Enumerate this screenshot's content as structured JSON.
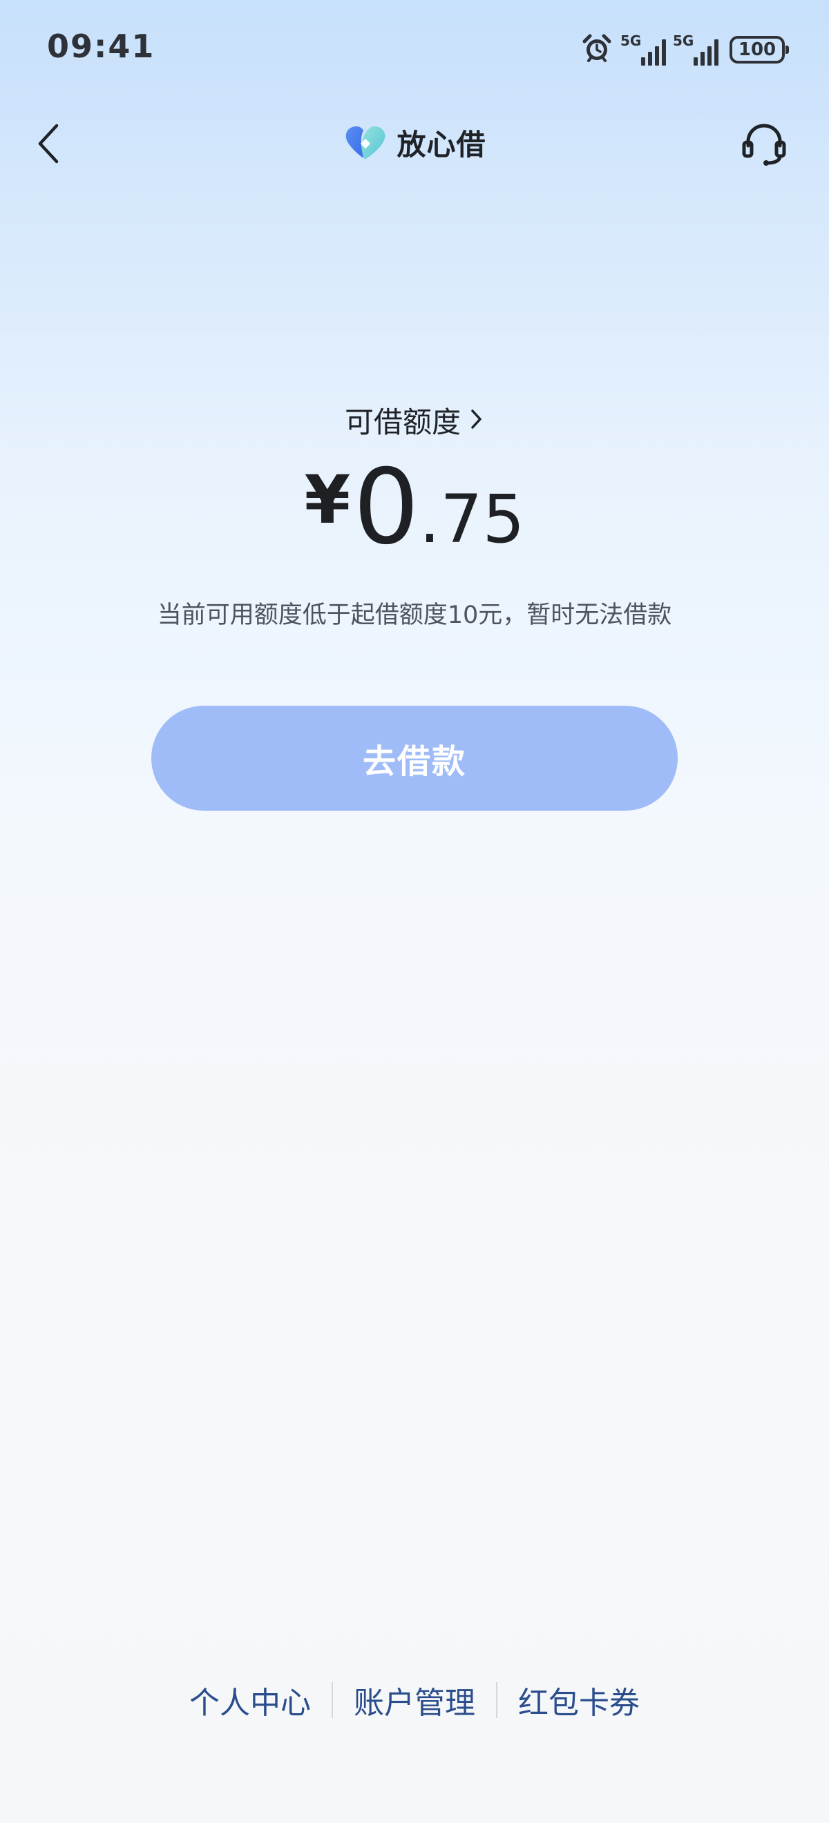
{
  "status_bar": {
    "time": "09:41",
    "network_1": "5G",
    "network_2": "5G",
    "battery": "100",
    "icons": [
      "alarm-icon",
      "signal-icon",
      "signal-icon",
      "battery-icon"
    ]
  },
  "header": {
    "brand_name": "放心借",
    "left_icon": "back-arrow-icon",
    "right_icon": "customer-service-headset-icon"
  },
  "credit": {
    "label": "可借额度",
    "currency_symbol": "¥",
    "amount_integer": "0",
    "amount_decimal": ".75",
    "notice": "当前可用额度低于起借额度10元，暂时无法借款"
  },
  "borrow_button": {
    "label": "去借款",
    "state": "disabled"
  },
  "footer": {
    "links": [
      "个人中心",
      "账户管理",
      "红包卡券"
    ]
  },
  "colors": {
    "button_disabled": "#9fbbf8",
    "footer_link": "#2a4d8c",
    "text_primary": "#1f2227",
    "text_secondary": "#4f545c"
  }
}
